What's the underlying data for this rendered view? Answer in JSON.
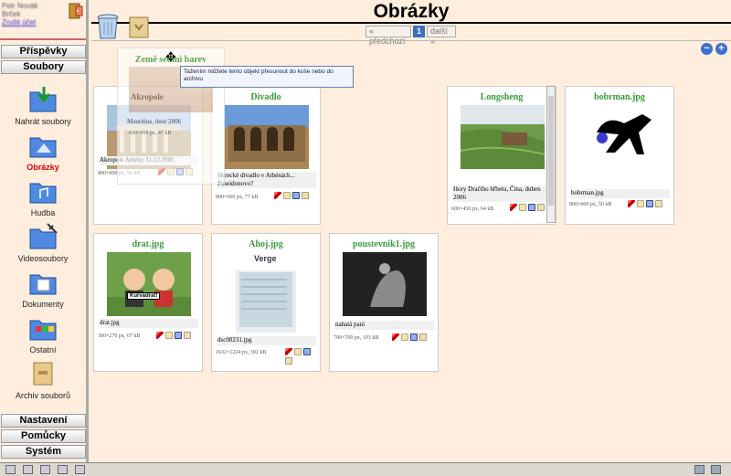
{
  "sidebar": {
    "user_lines": [
      "Petr Novák",
      "Brček",
      "Zrušit účet"
    ],
    "sections": {
      "posts": "Příspěvky",
      "files": "Soubory",
      "settings": "Nastavení",
      "tools": "Pomůcky",
      "system": "Systém"
    },
    "items": [
      {
        "label": "Nahrát soubory",
        "icon": "upload-folder-icon"
      },
      {
        "label": "Obrázky",
        "icon": "images-folder-icon"
      },
      {
        "label": "Hudba",
        "icon": "music-folder-icon"
      },
      {
        "label": "Videosoubory",
        "icon": "video-folder-icon"
      },
      {
        "label": "Dokumenty",
        "icon": "documents-folder-icon"
      },
      {
        "label": "Ostatní",
        "icon": "other-folder-icon"
      },
      {
        "label": "Archiv souborů",
        "icon": "archive-icon"
      }
    ]
  },
  "header": {
    "title": "Obrázky",
    "pager": {
      "prev": "« předchozí",
      "current": "1",
      "next": "další »"
    },
    "zoom_out": "−",
    "zoom_in": "+"
  },
  "drag": {
    "title": "Země sedmi barev",
    "tooltip": "Tažením můžete tento objekt přesunout do koše nebo do archivu",
    "under_title": "Akropole",
    "under_caption": "Mauritius, únor 2006",
    "under_meta": "600×450 px, 47 kB"
  },
  "cards": [
    {
      "title": "",
      "caption": "Akropole Athény 31.12.2005",
      "meta": "800×600 px, 96 kB"
    },
    {
      "title": "Divadlo",
      "caption": "Herecké divadlo v Athénách... Poseidonovo?",
      "meta": "800×600 px, 77 kB"
    },
    {
      "title": "Longsheng",
      "caption": "Hory Dračího hřbetu, Čína, duben 2006",
      "meta": "600×450 px, 64 kB"
    },
    {
      "title": "bobrman.jpg",
      "caption": "bobrman.jpg",
      "meta": "800×600 px, 50 kB"
    },
    {
      "title": "drat.jpg",
      "caption": "drat.jpg",
      "meta": "360×270 px, 67 kB",
      "sign": "Kurvadrat!"
    },
    {
      "title": "Ahoj.jpg",
      "caption": "dsc00231.jpg",
      "meta": "1632×1224 px, 302 kB",
      "sign": "Verge"
    },
    {
      "title": "poustevnik1.jpg",
      "caption": "nahatá paní",
      "meta": "700×700 px, 103 kB"
    }
  ]
}
